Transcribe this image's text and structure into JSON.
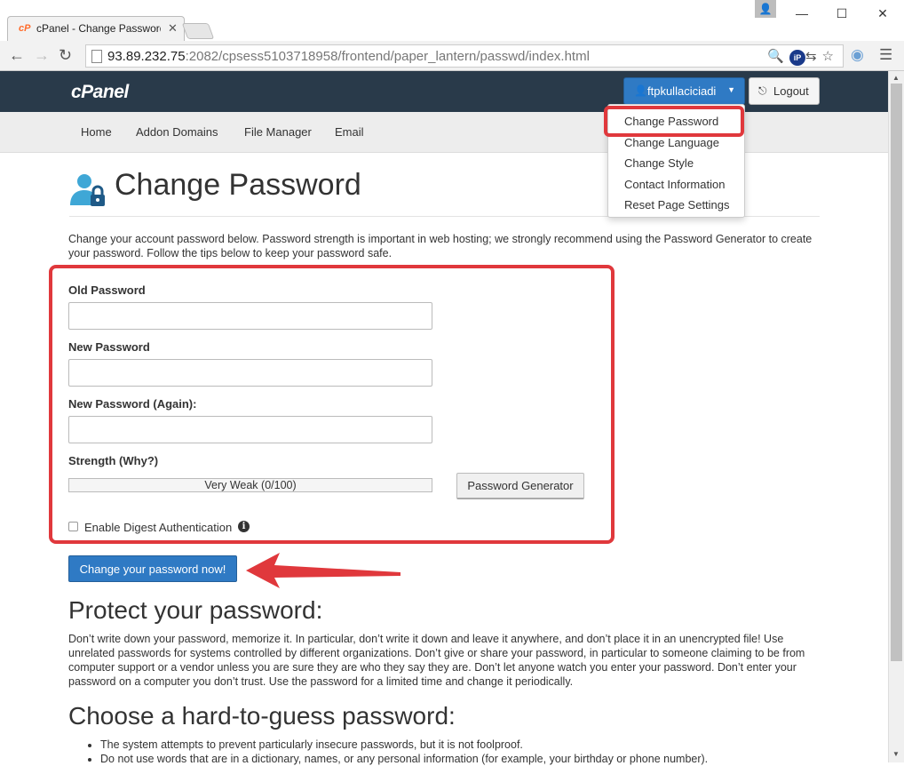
{
  "browser": {
    "tab_title": "cPanel - Change Password",
    "tab_favicon": "cP",
    "url_host": "93.89.232.75",
    "url_rest": ":2082/cpsess5103718958/frontend/paper_lantern/passwd/index.html",
    "window_controls": [
      "minimize-icon",
      "maximize-icon",
      "close-icon"
    ],
    "ip_badge": "iP"
  },
  "header": {
    "logo": "cPanel",
    "username": "ftpkullaciciadi",
    "logout_label": "Logout"
  },
  "user_menu": {
    "items": [
      "Change Password",
      "Change Language",
      "Change Style",
      "Contact Information",
      "Reset Page Settings"
    ]
  },
  "nav": {
    "items": [
      "Home",
      "Addon Domains",
      "File Manager",
      "Email"
    ]
  },
  "page": {
    "title": "Change Password",
    "intro": "Change your account password below. Password strength is important in web hosting; we strongly recommend using the Password Generator to create your password. Follow the tips below to keep your password safe."
  },
  "form": {
    "old_password_label": "Old Password",
    "new_password_label": "New Password",
    "new_password_again_label": "New Password (Again):",
    "strength_label": "Strength (Why?)",
    "strength_text": "Very Weak (0/100)",
    "strength_value": 0,
    "generator_label": "Password Generator",
    "digest_label": "Enable Digest Authentication",
    "submit_label": "Change your password now!"
  },
  "help": {
    "protect_heading": "Protect your password:",
    "protect_text": "Don’t write down your password, memorize it. In particular, don’t write it down and leave it anywhere, and don’t place it in an unencrypted file! Use unrelated passwords for systems controlled by different organizations. Don’t give or share your password, in particular to someone claiming to be from computer support or a vendor unless you are sure they are who they say they are. Don’t let anyone watch you enter your password. Don’t enter your password on a computer you don’t trust. Use the password for a limited time and change it periodically.",
    "choose_heading": "Choose a hard-to-guess password:",
    "bullets": [
      "The system attempts to prevent particularly insecure passwords, but it is not foolproof.",
      "Do not use words that are in a dictionary, names, or any personal information (for example, your birthday or phone number)."
    ]
  },
  "colors": {
    "header_bg": "#293a4a",
    "primary_button": "#2f7ac4",
    "annotation_red": "#e0383c"
  }
}
